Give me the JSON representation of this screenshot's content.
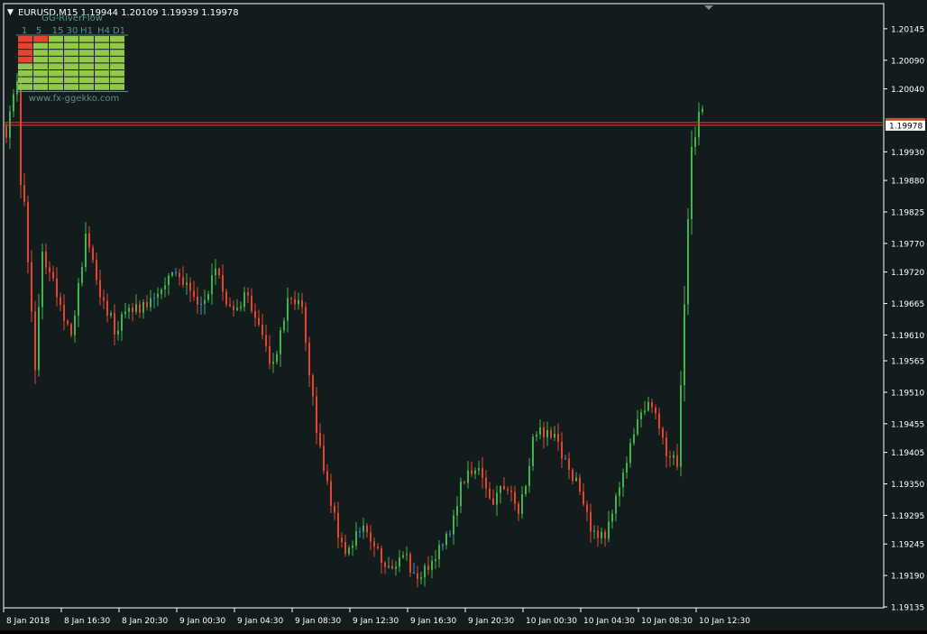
{
  "header": {
    "collapse_glyph": "▼",
    "title": "EURUSD,M15  1.19944 1.20109 1.19939 1.19978"
  },
  "indicator": {
    "name": "GG-RiverFlow",
    "timeframes": [
      "1",
      "5",
      "15",
      "30",
      "H1",
      "H4",
      "D1"
    ],
    "grid": [
      [
        "down",
        "down",
        "up",
        "up",
        "up",
        "up",
        "up"
      ],
      [
        "down",
        "up",
        "up",
        "up",
        "up",
        "up",
        "up"
      ],
      [
        "down",
        "up",
        "up",
        "up",
        "up",
        "up",
        "up"
      ],
      [
        "down",
        "up",
        "up",
        "up",
        "up",
        "up",
        "up"
      ],
      [
        "up",
        "up",
        "up",
        "up",
        "up",
        "up",
        "up"
      ],
      [
        "up",
        "up",
        "up",
        "up",
        "up",
        "up",
        "up"
      ],
      [
        "up",
        "up",
        "up",
        "up",
        "up",
        "up",
        "up"
      ],
      [
        "up",
        "up",
        "up",
        "up",
        "up",
        "up",
        "up"
      ]
    ],
    "website": "www.fx-ggekko.com"
  },
  "colors": {
    "background": "#121c1c",
    "frame": "#000000",
    "axis_text": "#ffffff",
    "bull": "#3cb54a",
    "bear": "#e8432f",
    "doji": "#3b8fd6",
    "price_line": "#e8432f",
    "price_label_bg": "#ffffff",
    "price_label_text": "#000000",
    "indicator_up": "#92c94a",
    "indicator_down": "#e8432f",
    "indicator_text": "#5a8f8f"
  },
  "chart_data": {
    "type": "candlestick",
    "symbol": "EURUSD",
    "timeframe": "M15",
    "ylim": [
      1.19135,
      1.2017
    ],
    "y_ticks": [
      "1.20145",
      "1.20090",
      "1.20040",
      "1.19930",
      "1.19880",
      "1.19825",
      "1.19770",
      "1.19720",
      "1.19665",
      "1.19610",
      "1.19565",
      "1.19510",
      "1.19455",
      "1.19405",
      "1.19350",
      "1.19295",
      "1.19245",
      "1.19190",
      "1.19135"
    ],
    "x_ticks": [
      "8 Jan 2018",
      "8 Jan 16:30",
      "8 Jan 20:30",
      "9 Jan 00:30",
      "9 Jan 04:30",
      "9 Jan 08:30",
      "9 Jan 12:30",
      "9 Jan 16:30",
      "9 Jan 20:30",
      "10 Jan 00:30",
      "10 Jan 04:30",
      "10 Jan 08:30",
      "10 Jan 12:30"
    ],
    "current_price": "1.19978",
    "grid": false,
    "anchors": [
      [
        0,
        1.1995
      ],
      [
        1,
        1.2001
      ],
      [
        2,
        1.2003
      ],
      [
        3,
        1.2006
      ],
      [
        4,
        1.1987
      ],
      [
        5,
        1.1983
      ],
      [
        8,
        1.1955
      ],
      [
        10,
        1.1975
      ],
      [
        14,
        1.1968
      ],
      [
        18,
        1.196
      ],
      [
        22,
        1.1978
      ],
      [
        26,
        1.1968
      ],
      [
        30,
        1.1962
      ],
      [
        34,
        1.1965
      ],
      [
        38,
        1.1966
      ],
      [
        42,
        1.1968
      ],
      [
        46,
        1.1972
      ],
      [
        50,
        1.197
      ],
      [
        54,
        1.1966
      ],
      [
        58,
        1.1972
      ],
      [
        62,
        1.1965
      ],
      [
        66,
        1.1968
      ],
      [
        70,
        1.1963
      ],
      [
        74,
        1.1955
      ],
      [
        78,
        1.1968
      ],
      [
        82,
        1.1965
      ],
      [
        86,
        1.1945
      ],
      [
        90,
        1.1932
      ],
      [
        94,
        1.1922
      ],
      [
        98,
        1.1928
      ],
      [
        102,
        1.1925
      ],
      [
        106,
        1.192
      ],
      [
        110,
        1.1923
      ],
      [
        114,
        1.1918
      ],
      [
        118,
        1.1922
      ],
      [
        122,
        1.1925
      ],
      [
        126,
        1.1935
      ],
      [
        130,
        1.1938
      ],
      [
        134,
        1.1932
      ],
      [
        138,
        1.1935
      ],
      [
        142,
        1.193
      ],
      [
        146,
        1.1942
      ],
      [
        150,
        1.1945
      ],
      [
        154,
        1.194
      ],
      [
        158,
        1.1935
      ],
      [
        162,
        1.1928
      ],
      [
        166,
        1.1925
      ],
      [
        170,
        1.1935
      ],
      [
        174,
        1.1945
      ],
      [
        178,
        1.195
      ],
      [
        182,
        1.1942
      ],
      [
        186,
        1.1938
      ],
      [
        190,
        1.1995
      ],
      [
        193,
        1.20005
      ]
    ]
  }
}
